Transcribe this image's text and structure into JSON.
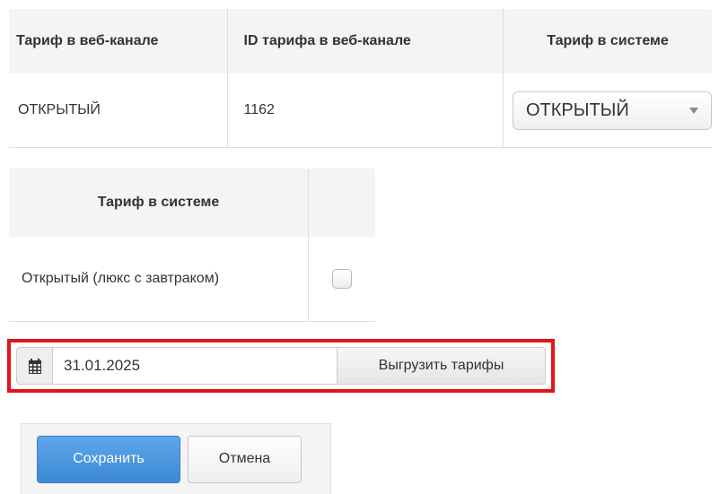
{
  "rate_mapping": {
    "headers": [
      "Тариф в веб-канале",
      "ID тарифа в веб-канале",
      "Тариф в системе"
    ],
    "row": {
      "web_rate": "ОТКРЫТЫЙ",
      "web_rate_id": "1162",
      "system_rate_selected": "ОТКРЫТЫЙ"
    }
  },
  "system_rates": {
    "header": "Тариф в системе",
    "rows": [
      {
        "name": "Открытый (люкс с завтраком)",
        "checked": false
      }
    ]
  },
  "export": {
    "calendar_icon": "calendar-icon",
    "date_value": "31.01.2025",
    "button_label": "Выгрузить тарифы",
    "highlight_color": "#e3141a"
  },
  "actions": {
    "save_label": "Сохранить",
    "cancel_label": "Отмена",
    "primary_color": "#4a95dd"
  }
}
